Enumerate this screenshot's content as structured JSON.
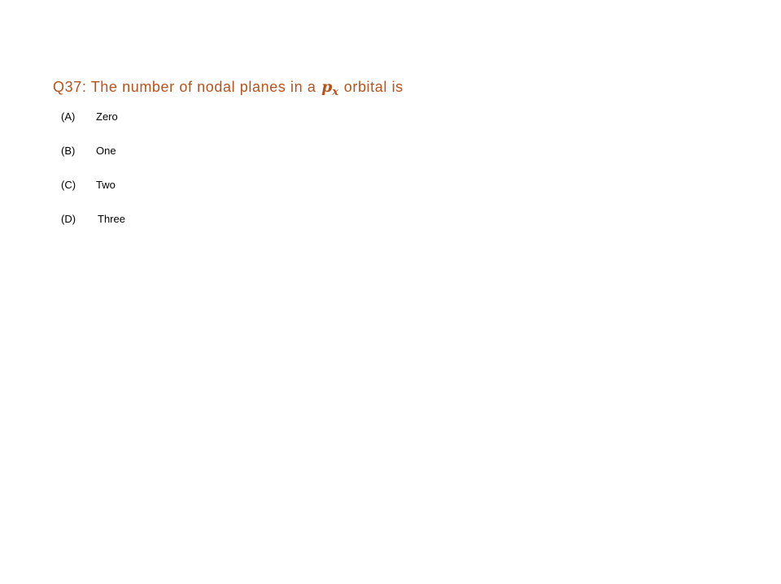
{
  "question": {
    "prefix": "Q37: The number of nodal planes in a ",
    "math_base": "p",
    "math_sub": "x",
    "suffix": " orbital is"
  },
  "options": [
    {
      "letter": "(A)",
      "text": "Zero"
    },
    {
      "letter": "(B)",
      "text": "One"
    },
    {
      "letter": "(C)",
      "text": "Two"
    },
    {
      "letter": "(D)",
      "text": "Three"
    }
  ],
  "colors": {
    "question_text": "#b5531d",
    "option_text": "#000000",
    "background": "#ffffff"
  }
}
